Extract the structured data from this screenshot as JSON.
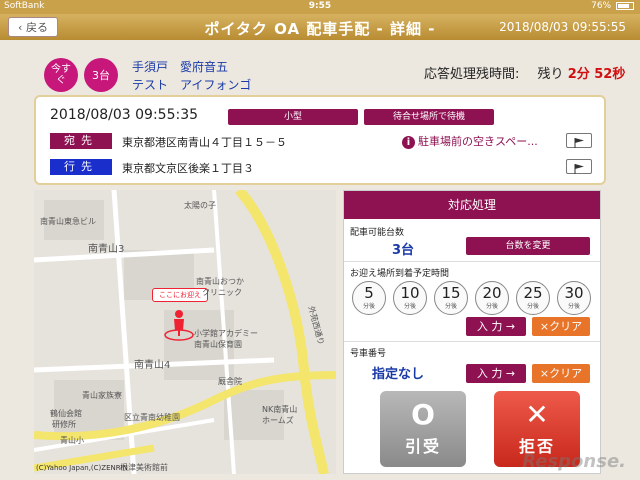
{
  "status_bar": {
    "carrier": "SoftBank",
    "time": "9:55",
    "battery": "76%"
  },
  "header": {
    "back_label": "戻る",
    "title": "ポイタク OA 配車手配 - 詳細 -",
    "datetime": "2018/08/03 09:55:55"
  },
  "info": {
    "badge_now": "今すぐ",
    "badge_count": "3台",
    "name_line1": "手須戸　愛府音五",
    "name_line2": "テスト　アイフォンゴ",
    "remaining_label": "応答処理残時間:",
    "remaining_prefix": "残り",
    "remaining_value": "2分 52秒"
  },
  "request": {
    "datetime": "2018/08/03 09:55:35",
    "vehicle_type": "小型",
    "wait_option": "待合せ場所で待機",
    "dest_label": "宛先",
    "dest_address": "東京都港区南青山４丁目１５－５",
    "dest_note": "駐車場前の空きスペー...",
    "goto_label": "行先",
    "goto_address": "東京都文京区後楽１丁目３"
  },
  "map": {
    "pin_label": "ここにお迎え",
    "labels": [
      "太陽の子",
      "南青山東急ビル",
      "南青山3",
      "南青山おつか",
      "クリニック",
      "小学館アカデミー",
      "南青山保育園",
      "南青山4",
      "青山家族寮",
      "鶴仙会館",
      "研修所",
      "青山小",
      "区立青南幼稚園",
      "NK南青山",
      "ホームズ",
      "根津美術館前",
      "外苑西通り",
      "厩舎院"
    ],
    "copyright": "(C)Yahoo Japan,(C)ZENRIN"
  },
  "panel": {
    "title": "対応処理",
    "dispatch_label": "配車可能台数",
    "dispatch_value": "3台",
    "change_btn": "台数を変更",
    "eta_label": "お迎え場所到着予定時間",
    "minutes": [
      "5",
      "10",
      "15",
      "20",
      "25",
      "30"
    ],
    "minute_unit": "分後",
    "input_btn": "入 力 →",
    "clear_btn": "×クリア",
    "car_label": "号車番号",
    "car_value": "指定なし",
    "accept_symbol": "O",
    "accept_label": "引受",
    "reject_symbol": "✕",
    "reject_label": "拒否"
  },
  "watermark": "Response."
}
